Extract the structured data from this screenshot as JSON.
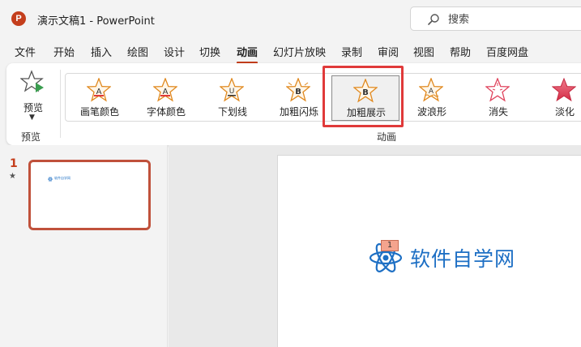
{
  "titlebar": {
    "app_logo_letter": "P",
    "document_title": "演示文稿1  -  PowerPoint",
    "search_placeholder": "搜索"
  },
  "menu": {
    "tabs": [
      "文件",
      "开始",
      "插入",
      "绘图",
      "设计",
      "切换",
      "动画",
      "幻灯片放映",
      "录制",
      "审阅",
      "视图",
      "帮助",
      "百度网盘"
    ],
    "active_tab": "动画"
  },
  "ribbon": {
    "preview_button": "预览",
    "preview_group": "预览",
    "animation_group": "动画",
    "effects": [
      {
        "label": "画笔颜色",
        "glyph": "A"
      },
      {
        "label": "字体颜色",
        "glyph": "A"
      },
      {
        "label": "下划线",
        "glyph": "U"
      },
      {
        "label": "加粗闪烁",
        "glyph": "B"
      },
      {
        "label": "加粗展示",
        "glyph": "B"
      },
      {
        "label": "波浪形",
        "glyph": "A"
      },
      {
        "label": "消失",
        "glyph": ""
      },
      {
        "label": "淡化",
        "glyph": ""
      }
    ],
    "selected_effect": "加粗展示"
  },
  "slides": {
    "current_number": "1",
    "thumbnail_text": "软件自学网"
  },
  "slide": {
    "logo_text": "软件自学网",
    "animation_tag": "1"
  },
  "colors": {
    "accent": "#c43e1c",
    "highlight": "#e03a3a",
    "logo_blue": "#1d6fc4",
    "star_emphasis": "#e0891f",
    "star_exit": "#e0435c"
  }
}
